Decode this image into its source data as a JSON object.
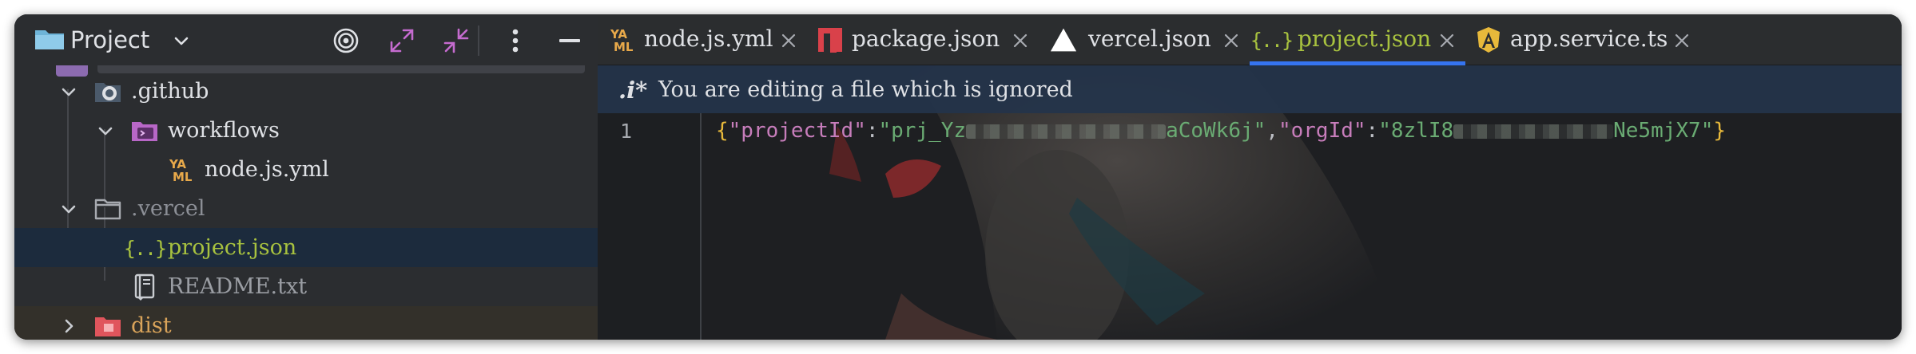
{
  "project_panel": {
    "title": "Project",
    "tree": [
      {
        "label": ".github",
        "kind": "folder-github",
        "expanded": true
      },
      {
        "label": "workflows",
        "kind": "folder-workflows",
        "expanded": true
      },
      {
        "label": "node.js.yml",
        "kind": "yaml-file"
      },
      {
        "label": ".vercel",
        "kind": "folder",
        "expanded": true
      },
      {
        "label": "project.json",
        "kind": "json-file",
        "selected": true
      },
      {
        "label": "README.txt",
        "kind": "text-file"
      },
      {
        "label": "dist",
        "kind": "folder-dist",
        "expanded": false
      }
    ]
  },
  "tabs": [
    {
      "label": "node.js.yml",
      "icon": "yaml-icon"
    },
    {
      "label": "package.json",
      "icon": "npm-icon"
    },
    {
      "label": "vercel.json",
      "icon": "vercel-icon"
    },
    {
      "label": "project.json",
      "icon": "json-icon",
      "active": true
    },
    {
      "label": "app.service.ts",
      "icon": "angular-icon"
    }
  ],
  "banner": {
    "icon_text": ".i*",
    "text": "You are editing a file which is ignored"
  },
  "editor": {
    "line_number": "1",
    "code": {
      "open_brace": "{",
      "key1": "\"projectId\"",
      "colon": ":",
      "val1_start": "\"prj_Yz",
      "val1_end": "aCoWk6j\"",
      "comma": ",",
      "key2": "\"orgId\"",
      "val2_start": "\"8zlI8",
      "val2_end": "Ne5mjX7\"",
      "close_brace": "}"
    }
  },
  "colors": {
    "accent": "#3574f0",
    "active_tab_text": "#a8c23f",
    "selection": "#1c2b3d",
    "banner": "#24344a"
  }
}
